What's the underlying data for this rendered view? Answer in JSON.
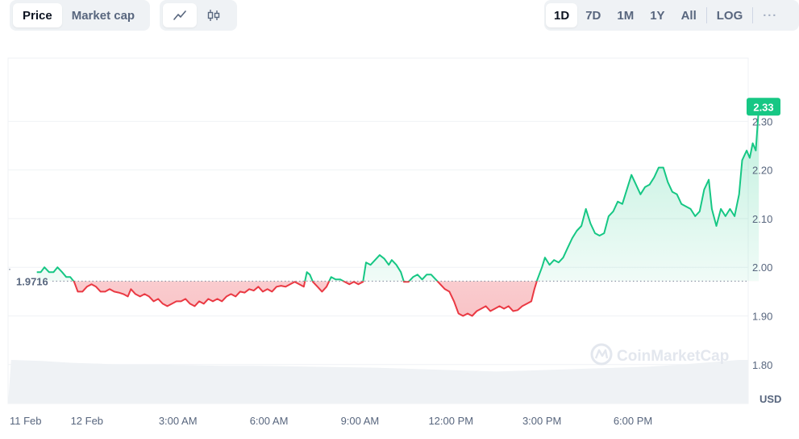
{
  "toolbar": {
    "metric_tabs": [
      {
        "label": "Price",
        "active": true
      },
      {
        "label": "Market cap",
        "active": false
      }
    ],
    "chart_type_buttons": [
      {
        "icon": "line-chart-icon",
        "active": true
      },
      {
        "icon": "candlestick-icon",
        "active": false
      }
    ],
    "range_tabs": [
      {
        "label": "1D",
        "active": true
      },
      {
        "label": "7D",
        "active": false
      },
      {
        "label": "1M",
        "active": false
      },
      {
        "label": "1Y",
        "active": false
      },
      {
        "label": "All",
        "active": false
      }
    ],
    "log_label": "LOG",
    "more_label": "···"
  },
  "watermark": {
    "text": "CoinMarketCap",
    "icon": "coinmarketcap-logo-icon"
  },
  "colors": {
    "up": "#16c784",
    "down": "#ea3943",
    "grid": "#eff2f5",
    "axis_text": "#58667e",
    "volume": "#eff2f5"
  },
  "chart_data": {
    "type": "area",
    "baseline": {
      "value": 1.9716,
      "label": "1.9716"
    },
    "last_price": {
      "value": 2.33,
      "label": "2.33"
    },
    "ylim": [
      1.72,
      2.43
    ],
    "y_ticks": [
      {
        "value": 1.8,
        "label": "1.80"
      },
      {
        "value": 1.9,
        "label": "1.90"
      },
      {
        "value": 2.0,
        "label": "2.00"
      },
      {
        "value": 2.1,
        "label": "2.10"
      },
      {
        "value": 2.2,
        "label": "2.20"
      },
      {
        "value": 2.3,
        "label": "2.30"
      }
    ],
    "currency_label": "USD",
    "xlim": [
      -2.6,
      21.8
    ],
    "x_ticks": [
      {
        "value": -2.33,
        "label": "11 Feb"
      },
      {
        "value": 0,
        "label": "12 Feb"
      },
      {
        "value": 3,
        "label": "3:00 AM"
      },
      {
        "value": 6,
        "label": "6:00 AM"
      },
      {
        "value": 9,
        "label": "9:00 AM"
      },
      {
        "value": 12,
        "label": "12:00 PM"
      },
      {
        "value": 15,
        "label": "3:00 PM"
      },
      {
        "value": 18,
        "label": "6:00 PM"
      }
    ],
    "series": [
      {
        "values": [
          [
            -1.65,
            1.99
          ],
          [
            -1.52,
            1.99
          ],
          [
            -1.4,
            2.0
          ],
          [
            -1.25,
            1.99
          ],
          [
            -1.1,
            1.99
          ],
          [
            -0.97,
            2.0
          ],
          [
            -0.82,
            1.99
          ],
          [
            -0.68,
            1.98
          ],
          [
            -0.55,
            1.98
          ],
          [
            -0.42,
            1.97
          ],
          [
            -0.3,
            1.95
          ],
          [
            -0.15,
            1.95
          ],
          [
            0.0,
            1.96
          ],
          [
            0.15,
            1.965
          ],
          [
            0.3,
            1.96
          ],
          [
            0.45,
            1.95
          ],
          [
            0.6,
            1.95
          ],
          [
            0.75,
            1.955
          ],
          [
            0.9,
            1.95
          ],
          [
            1.05,
            1.948
          ],
          [
            1.2,
            1.945
          ],
          [
            1.35,
            1.94
          ],
          [
            1.45,
            1.955
          ],
          [
            1.6,
            1.945
          ],
          [
            1.75,
            1.94
          ],
          [
            1.9,
            1.945
          ],
          [
            2.05,
            1.94
          ],
          [
            2.2,
            1.93
          ],
          [
            2.35,
            1.935
          ],
          [
            2.5,
            1.925
          ],
          [
            2.65,
            1.92
          ],
          [
            2.8,
            1.925
          ],
          [
            2.95,
            1.93
          ],
          [
            3.1,
            1.93
          ],
          [
            3.25,
            1.935
          ],
          [
            3.4,
            1.925
          ],
          [
            3.55,
            1.92
          ],
          [
            3.7,
            1.93
          ],
          [
            3.85,
            1.925
          ],
          [
            4.0,
            1.935
          ],
          [
            4.15,
            1.93
          ],
          [
            4.3,
            1.935
          ],
          [
            4.45,
            1.93
          ],
          [
            4.6,
            1.94
          ],
          [
            4.75,
            1.945
          ],
          [
            4.9,
            1.94
          ],
          [
            5.05,
            1.95
          ],
          [
            5.2,
            1.948
          ],
          [
            5.35,
            1.955
          ],
          [
            5.5,
            1.952
          ],
          [
            5.65,
            1.96
          ],
          [
            5.8,
            1.95
          ],
          [
            5.95,
            1.955
          ],
          [
            6.1,
            1.95
          ],
          [
            6.25,
            1.96
          ],
          [
            6.4,
            1.962
          ],
          [
            6.55,
            1.96
          ],
          [
            6.7,
            1.965
          ],
          [
            6.85,
            1.97
          ],
          [
            7.0,
            1.965
          ],
          [
            7.15,
            1.96
          ],
          [
            7.25,
            1.99
          ],
          [
            7.35,
            1.985
          ],
          [
            7.45,
            1.97
          ],
          [
            7.6,
            1.96
          ],
          [
            7.75,
            1.95
          ],
          [
            7.9,
            1.96
          ],
          [
            8.05,
            1.98
          ],
          [
            8.2,
            1.975
          ],
          [
            8.35,
            1.975
          ],
          [
            8.5,
            1.97
          ],
          [
            8.65,
            1.965
          ],
          [
            8.8,
            1.97
          ],
          [
            8.95,
            1.965
          ],
          [
            9.1,
            1.97
          ],
          [
            9.2,
            2.01
          ],
          [
            9.35,
            2.005
          ],
          [
            9.5,
            2.015
          ],
          [
            9.65,
            2.025
          ],
          [
            9.8,
            2.018
          ],
          [
            9.95,
            2.005
          ],
          [
            10.05,
            2.015
          ],
          [
            10.2,
            2.005
          ],
          [
            10.35,
            1.99
          ],
          [
            10.45,
            1.97
          ],
          [
            10.6,
            1.97
          ],
          [
            10.75,
            1.98
          ],
          [
            10.9,
            1.985
          ],
          [
            11.05,
            1.975
          ],
          [
            11.2,
            1.985
          ],
          [
            11.35,
            1.985
          ],
          [
            11.5,
            1.975
          ],
          [
            11.65,
            1.965
          ],
          [
            11.8,
            1.955
          ],
          [
            11.95,
            1.95
          ],
          [
            12.1,
            1.93
          ],
          [
            12.25,
            1.905
          ],
          [
            12.4,
            1.9
          ],
          [
            12.55,
            1.905
          ],
          [
            12.7,
            1.9
          ],
          [
            12.85,
            1.91
          ],
          [
            13.0,
            1.915
          ],
          [
            13.15,
            1.92
          ],
          [
            13.3,
            1.91
          ],
          [
            13.45,
            1.915
          ],
          [
            13.6,
            1.92
          ],
          [
            13.75,
            1.915
          ],
          [
            13.9,
            1.92
          ],
          [
            14.05,
            1.91
          ],
          [
            14.2,
            1.912
          ],
          [
            14.35,
            1.92
          ],
          [
            14.5,
            1.925
          ],
          [
            14.65,
            1.93
          ],
          [
            14.75,
            1.955
          ],
          [
            14.85,
            1.975
          ],
          [
            15.0,
            2.0
          ],
          [
            15.1,
            2.02
          ],
          [
            15.25,
            2.005
          ],
          [
            15.4,
            2.015
          ],
          [
            15.55,
            2.01
          ],
          [
            15.7,
            2.02
          ],
          [
            15.85,
            2.04
          ],
          [
            16.0,
            2.06
          ],
          [
            16.15,
            2.075
          ],
          [
            16.3,
            2.085
          ],
          [
            16.45,
            2.12
          ],
          [
            16.6,
            2.09
          ],
          [
            16.75,
            2.07
          ],
          [
            16.9,
            2.065
          ],
          [
            17.05,
            2.07
          ],
          [
            17.2,
            2.105
          ],
          [
            17.35,
            2.115
          ],
          [
            17.5,
            2.135
          ],
          [
            17.65,
            2.13
          ],
          [
            17.8,
            2.16
          ],
          [
            17.95,
            2.19
          ],
          [
            18.1,
            2.17
          ],
          [
            18.25,
            2.15
          ],
          [
            18.4,
            2.165
          ],
          [
            18.55,
            2.17
          ],
          [
            18.7,
            2.185
          ],
          [
            18.85,
            2.205
          ],
          [
            19.0,
            2.205
          ],
          [
            19.15,
            2.175
          ],
          [
            19.3,
            2.155
          ],
          [
            19.45,
            2.15
          ],
          [
            19.6,
            2.13
          ],
          [
            19.75,
            2.125
          ],
          [
            19.9,
            2.12
          ],
          [
            20.05,
            2.105
          ],
          [
            20.2,
            2.115
          ],
          [
            20.35,
            2.16
          ],
          [
            20.5,
            2.18
          ],
          [
            20.6,
            2.12
          ],
          [
            20.75,
            2.085
          ],
          [
            20.9,
            2.12
          ],
          [
            21.05,
            2.105
          ],
          [
            21.2,
            2.12
          ],
          [
            21.35,
            2.105
          ],
          [
            21.5,
            2.15
          ],
          [
            21.6,
            2.22
          ],
          [
            21.75,
            2.24
          ],
          [
            21.85,
            2.225
          ],
          [
            21.95,
            2.255
          ],
          [
            22.05,
            2.24
          ],
          [
            22.15,
            2.33
          ]
        ]
      }
    ],
    "volume": [
      [
        -2.5,
        0.9
      ],
      [
        -1.5,
        0.88
      ],
      [
        -0.5,
        0.84
      ],
      [
        0.5,
        0.82
      ],
      [
        1.5,
        0.8
      ],
      [
        2.5,
        0.8
      ],
      [
        3.5,
        0.79
      ],
      [
        4.5,
        0.78
      ],
      [
        5.5,
        0.78
      ],
      [
        6.5,
        0.77
      ],
      [
        7.5,
        0.76
      ],
      [
        8.5,
        0.75
      ],
      [
        9.5,
        0.74
      ],
      [
        10.5,
        0.72
      ],
      [
        11.5,
        0.7
      ],
      [
        12.5,
        0.68
      ],
      [
        13.5,
        0.66
      ],
      [
        14.5,
        0.68
      ],
      [
        15.5,
        0.7
      ],
      [
        16.5,
        0.72
      ],
      [
        17.5,
        0.74
      ],
      [
        18.5,
        0.76
      ],
      [
        19.5,
        0.8
      ],
      [
        20.5,
        0.85
      ],
      [
        21.5,
        0.9
      ]
    ]
  }
}
